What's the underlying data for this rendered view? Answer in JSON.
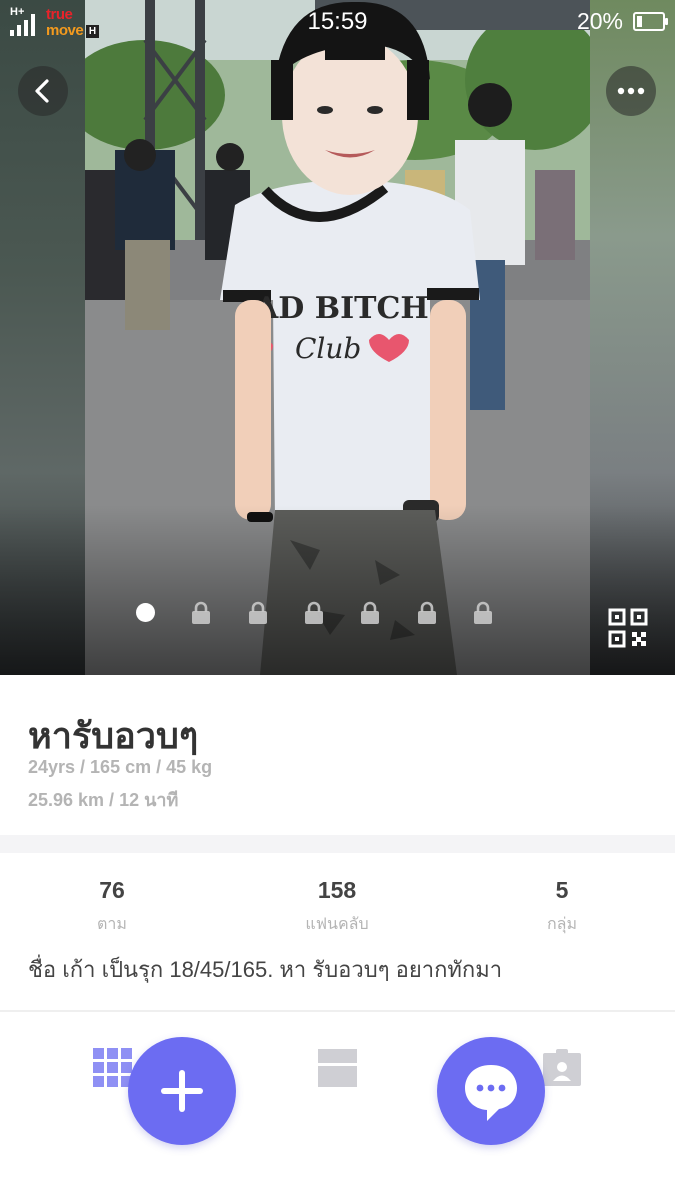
{
  "status_bar": {
    "network_label": "H+",
    "carrier_line1": "true",
    "carrier_line2": "move",
    "carrier_badge": "H",
    "time": "15:59",
    "battery_percent": "20%",
    "battery_level": 0.2
  },
  "header": {
    "back_icon": "chevron-left-icon",
    "more_icon": "more-dots-icon"
  },
  "photo_pager": {
    "total_pages": 7,
    "current_page": 1,
    "locked_pages": 6,
    "qr_icon": "qr-code-icon"
  },
  "profile": {
    "name": "หารับอวบๆ",
    "stats_line": "24yrs / 165 cm / 45 kg",
    "distance_line": "25.96 km / 12 นาที"
  },
  "counts": [
    {
      "value": "76",
      "label": "ตาม"
    },
    {
      "value": "158",
      "label": "แฟนคลับ"
    },
    {
      "value": "5",
      "label": "กลุ่ม"
    }
  ],
  "bio": "ชื่อ เก้า เป็นรุก 18/45/165. หา รับอวบๆ อยากทักมา",
  "tabs": {
    "grid_icon": "grid-icon",
    "feed_icon": "feed-icon",
    "profile_card_icon": "id-card-icon"
  },
  "actions": {
    "add_icon": "plus-icon",
    "chat_icon": "chat-bubble-icon"
  },
  "colors": {
    "accent": "#6c6cf2",
    "grid_icon": "#8f90f4",
    "inactive_icon": "#cfcfd4"
  }
}
